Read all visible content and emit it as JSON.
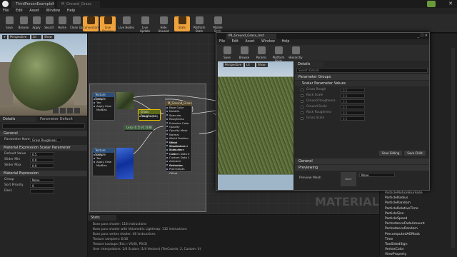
{
  "window": {
    "tab_main": "ThirdPersonExampleMap",
    "tab_material": "M_Ground_Grass"
  },
  "menubar": [
    "File",
    "Edit",
    "Asset",
    "Window",
    "Help"
  ],
  "toolbar": [
    {
      "label": "Save",
      "active": false
    },
    {
      "label": "Browse",
      "active": false
    },
    {
      "label": "Apply",
      "active": false
    },
    {
      "label": "Search",
      "active": false
    },
    {
      "label": "Home",
      "active": false
    },
    {
      "label": "Clean Up",
      "active": false
    },
    {
      "label": "Connectors",
      "active": true
    },
    {
      "label": "Live Preview",
      "active": true
    },
    {
      "label": "Live Nodes",
      "active": false
    },
    {
      "label": "Live Update",
      "active": false
    },
    {
      "label": "Hide Unused",
      "active": false
    },
    {
      "label": "Stats",
      "active": true
    },
    {
      "label": "Platform Stats",
      "active": false
    },
    {
      "label": "Mobile Stats",
      "active": false
    }
  ],
  "viewport": {
    "perspective": "Perspective",
    "lit": "Lit",
    "show": "Show"
  },
  "details": {
    "header": "Details",
    "tab2": "Parameter Default",
    "general_label": "General",
    "param_name_label": "Parameter Name",
    "param_name_value": "Grass Roughness",
    "scalar_section": "Material Expression Scalar Parameter",
    "default_label": "Default Value",
    "default_value": "0.5",
    "slider_min_label": "Slider Min",
    "slider_min_value": "0.0",
    "slider_max_label": "Slider Max",
    "slider_max_value": "0.0",
    "expr_section": "Material Expression",
    "group_label": "Group",
    "group_value": "None",
    "sort_label": "Sort Priority",
    "sort_value": "0",
    "desc_label": "Desc"
  },
  "graph": {
    "node_tex1": "Texture Sample",
    "node_tex2": "Texture Sample",
    "node_param": "Grass Roughness",
    "node_param_value": "Param (0.5)",
    "node_lerp": "Lerp (0.5) (0.5)(8)",
    "node_main": "M_Ground_Grass",
    "tex_pins": [
      "UVs",
      "Tex",
      "Apply View MipBias"
    ],
    "main_pins": [
      "Base Color",
      "Metallic",
      "Specular",
      "Roughness",
      "Emissive Color",
      "Opacity",
      "Opacity Mask",
      "Normal",
      "World Position Offset",
      "World Displacement",
      "Tessellation Multiplier",
      "Subsurface Color",
      "Custom Data 0",
      "Custom Data 1",
      "Ambient Occlusion",
      "Refraction",
      "Pixel Depth Offset"
    ],
    "watermark": "MATERIAL"
  },
  "instance_window": {
    "title": "MI_Ground_Grass_Inst",
    "menu": [
      "File",
      "Edit",
      "Asset",
      "Window",
      "Help"
    ],
    "toolbar": [
      "Save",
      "Browse",
      "Params",
      "Platform Stats",
      "Hierarchy"
    ],
    "viewport_perspective": "Perspective",
    "viewport_lit": "Lit",
    "viewport_show": "Show",
    "details_tab": "Details",
    "search_placeholder": "Search Details",
    "param_groups": "Parameter Groups",
    "scalar_values": "Scalar Parameter Values",
    "params": [
      {
        "name": "Grass Rough",
        "value": "0.5"
      },
      {
        "name": "Rock Scale",
        "value": "0.5"
      },
      {
        "name": "Ground Roughness",
        "value": "0.5"
      },
      {
        "name": "Ground Scale",
        "value": "0.5"
      },
      {
        "name": "Rock Roughness",
        "value": "0.5"
      },
      {
        "name": "Grass Scale",
        "value": "0.5"
      }
    ],
    "save_sibling": "Save Sibling",
    "save_child": "Save Child",
    "general": "General",
    "previewing": "Previewing",
    "preview_mesh_label": "Preview Mesh",
    "preview_mesh_value": "None",
    "preview_thumb": "None"
  },
  "palette": [
    "ParticleMotionBlurFade",
    "ParticleRadius",
    "ParticleRandom",
    "ParticleRelativeTime",
    "ParticleSize",
    "ParticleSpeed",
    "PerInstanceFadeAmount",
    "PerInstanceRandom",
    "PrecomputedAOMask",
    "Time",
    "TwoSidedSign",
    "VertexColor",
    "ViewProperty"
  ],
  "stats": {
    "header": "Stats",
    "lines": [
      "Base pass shader: 118 instructions",
      "Base pass shader with Volumetric Lightmap: 132 instructions",
      "Base pass vertex shader: 46 instructions",
      "Texture samplers: 6/16",
      "Texture Lookups (Est.): VS(0), PS(3)",
      "User interpolators: 2/4 Scalars (1/4 Vectors) (TexCoords: 2, Custom: 0)"
    ]
  }
}
